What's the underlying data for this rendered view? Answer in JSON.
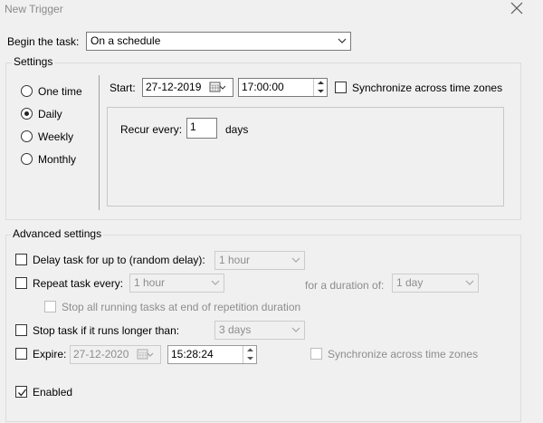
{
  "window": {
    "title": "New Trigger"
  },
  "begin_task": {
    "label": "Begin the task:",
    "value": "On a schedule"
  },
  "settings": {
    "legend": "Settings",
    "schedule_options": [
      "One time",
      "Daily",
      "Weekly",
      "Monthly"
    ],
    "selected": "Daily",
    "start_label": "Start:",
    "start_date": "27-12-2019",
    "start_time": "17:00:00",
    "sync_label": "Synchronize across time zones",
    "sync_checked": false,
    "recur_label": "Recur every:",
    "recur_value": "1",
    "recur_unit": "days"
  },
  "advanced": {
    "legend": "Advanced settings",
    "delay_label": "Delay task for up to (random delay):",
    "delay_value": "1 hour",
    "repeat_label": "Repeat task every:",
    "repeat_value": "1 hour",
    "duration_label": "for a duration of:",
    "duration_value": "1 day",
    "stop_running_label": "Stop all running tasks at end of repetition duration",
    "stop_longer_label": "Stop task if it runs longer than:",
    "stop_longer_value": "3 days",
    "expire_label": "Expire:",
    "expire_date": "27-12-2020",
    "expire_time": "15:28:24",
    "expire_sync_label": "Synchronize across time zones",
    "enabled_label": "Enabled",
    "enabled_checked": true
  },
  "icons": {
    "close": "close-icon",
    "dropdown": "chevron-down-icon",
    "calendar": "calendar-icon",
    "spinner": "spinner-icon",
    "check": "checkmark-icon"
  }
}
